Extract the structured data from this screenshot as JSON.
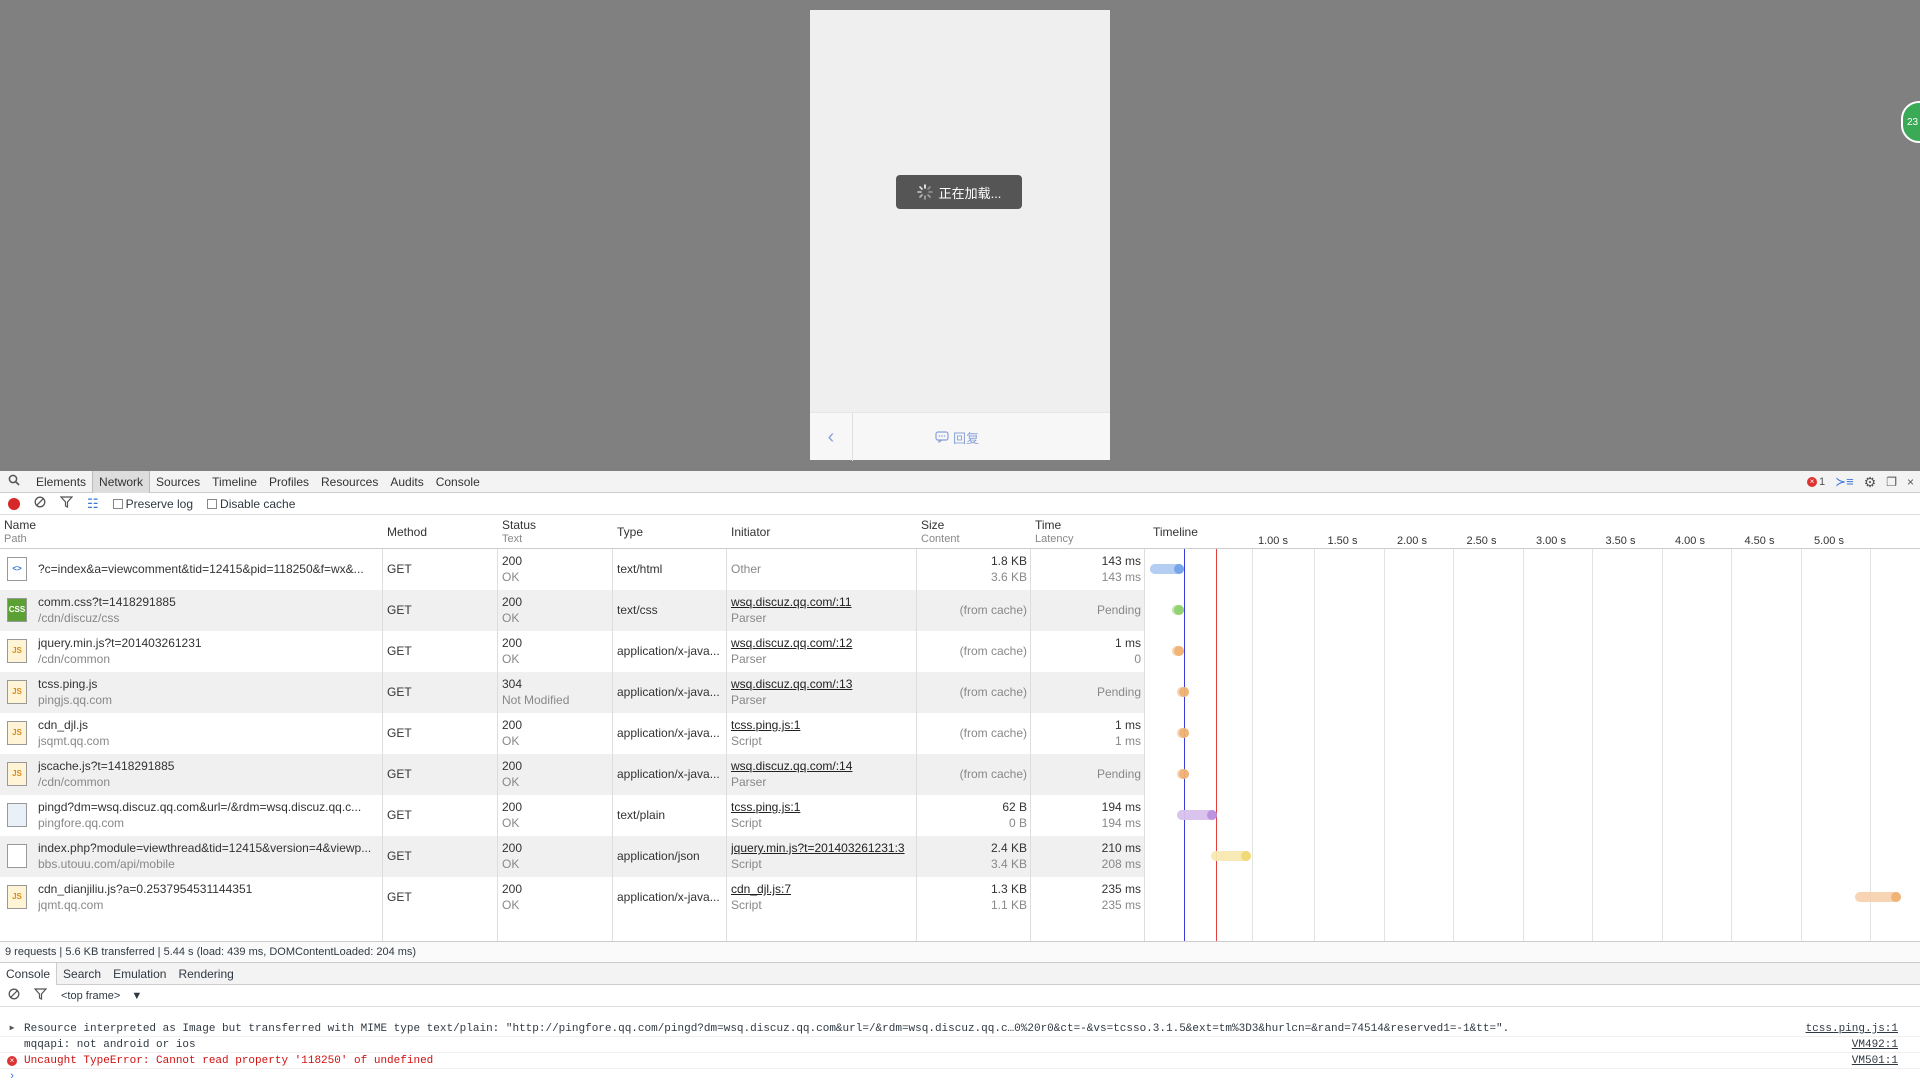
{
  "viewport": {
    "loading_text": "正在加载...",
    "back_icon": "chevron-left-icon",
    "reply_label": "回复",
    "extension_badge": "23"
  },
  "devtools": {
    "main_tabs": [
      "Elements",
      "Network",
      "Sources",
      "Timeline",
      "Profiles",
      "Resources",
      "Audits",
      "Console"
    ],
    "selected_tab": "Network",
    "error_count": "1",
    "toolbar": {
      "preserve_log": "Preserve log",
      "disable_cache": "Disable cache"
    },
    "columns": {
      "name": "Name",
      "name_sub": "Path",
      "method": "Method",
      "status": "Status",
      "status_sub": "Text",
      "type": "Type",
      "initiator": "Initiator",
      "size": "Size",
      "size_sub": "Content",
      "time": "Time",
      "time_sub": "Latency",
      "timeline": "Timeline"
    },
    "timeline_ticks": [
      "1.00 s",
      "1.50 s",
      "2.00 s",
      "2.50 s",
      "3.00 s",
      "3.50 s",
      "4.00 s",
      "4.50 s",
      "5.00 s"
    ],
    "requests": [
      {
        "name": "?c=index&a=viewcomment&tid=12415&pid=118250&f=wx&...",
        "path": "",
        "method": "GET",
        "status": "200",
        "status_text": "OK",
        "type": "text/html",
        "initiator": "Other",
        "initiator_sub": "",
        "initiator_link": false,
        "size": "1.8 KB",
        "content": "3.6 KB",
        "time": "143 ms",
        "latency": "143 ms",
        "icon": "html",
        "color": "#6fa0e8"
      },
      {
        "name": "comm.css?t=1418291885",
        "path": "/cdn/discuz/css",
        "method": "GET",
        "status": "200",
        "status_text": "OK",
        "type": "text/css",
        "initiator": "wsq.discuz.qq.com/:11",
        "initiator_sub": "Parser",
        "initiator_link": true,
        "size": "(from cache)",
        "content": "",
        "time": "Pending",
        "latency": "",
        "icon": "css",
        "color": "#8ed06a"
      },
      {
        "name": "jquery.min.js?t=201403261231",
        "path": "/cdn/common",
        "method": "GET",
        "status": "200",
        "status_text": "OK",
        "type": "application/x-java...",
        "initiator": "wsq.discuz.qq.com/:12",
        "initiator_sub": "Parser",
        "initiator_link": true,
        "size": "(from cache)",
        "content": "",
        "time": "1 ms",
        "latency": "0",
        "icon": "js",
        "color": "#f0b070"
      },
      {
        "name": "tcss.ping.js",
        "path": "pingjs.qq.com",
        "method": "GET",
        "status": "304",
        "status_text": "Not Modified",
        "type": "application/x-java...",
        "initiator": "wsq.discuz.qq.com/:13",
        "initiator_sub": "Parser",
        "initiator_link": true,
        "size": "(from cache)",
        "content": "",
        "time": "Pending",
        "latency": "",
        "icon": "js",
        "color": "#f0b070"
      },
      {
        "name": "cdn_djl.js",
        "path": "jsqmt.qq.com",
        "method": "GET",
        "status": "200",
        "status_text": "OK",
        "type": "application/x-java...",
        "initiator": "tcss.ping.js:1",
        "initiator_sub": "Script",
        "initiator_link": true,
        "size": "(from cache)",
        "content": "",
        "time": "1 ms",
        "latency": "1 ms",
        "icon": "js",
        "color": "#f0b070"
      },
      {
        "name": "jscache.js?t=1418291885",
        "path": "/cdn/common",
        "method": "GET",
        "status": "200",
        "status_text": "OK",
        "type": "application/x-java...",
        "initiator": "wsq.discuz.qq.com/:14",
        "initiator_sub": "Parser",
        "initiator_link": true,
        "size": "(from cache)",
        "content": "",
        "time": "Pending",
        "latency": "",
        "icon": "js",
        "color": "#f0b070"
      },
      {
        "name": "pingd?dm=wsq.discuz.qq.com&url=/&rdm=wsq.discuz.qq.c...",
        "path": "pingfore.qq.com",
        "method": "GET",
        "status": "200",
        "status_text": "OK",
        "type": "text/plain",
        "initiator": "tcss.ping.js:1",
        "initiator_sub": "Script",
        "initiator_link": true,
        "size": "62 B",
        "content": "0 B",
        "time": "194 ms",
        "latency": "194 ms",
        "icon": "img",
        "color": "#b88ee0"
      },
      {
        "name": "index.php?module=viewthread&tid=12415&version=4&viewp...",
        "path": "bbs.utouu.com/api/mobile",
        "method": "GET",
        "status": "200",
        "status_text": "OK",
        "type": "application/json",
        "initiator": "jquery.min.js?t=201403261231:3",
        "initiator_sub": "Script",
        "initiator_link": true,
        "size": "2.4 KB",
        "content": "3.4 KB",
        "time": "210 ms",
        "latency": "208 ms",
        "icon": "blank",
        "color": "#f2d870"
      },
      {
        "name": "cdn_dianjiliu.js?a=0.2537954531144351",
        "path": "jqmt.qq.com",
        "method": "GET",
        "status": "200",
        "status_text": "OK",
        "type": "application/x-java...",
        "initiator": "cdn_djl.js:7",
        "initiator_sub": "Script",
        "initiator_link": true,
        "size": "1.3 KB",
        "content": "1.1 KB",
        "time": "235 ms",
        "latency": "235 ms",
        "icon": "js",
        "color": "#f0b070"
      }
    ],
    "status_bar": "9 requests | 5.6 KB transferred | 5.44 s (load: 439 ms, DOMContentLoaded: 204 ms)",
    "drawer_tabs": [
      "Console",
      "Search",
      "Emulation",
      "Rendering"
    ],
    "frame_selector": "<top frame>",
    "console_lines": [
      {
        "text": "Resource interpreted as Image but transferred with MIME type text/plain: \"http://pingfore.qq.com/pingd?dm=wsq.discuz.qq.com&url=/&rdm=wsq.discuz.qq.c…0%20r0&ct=-&vs=tcsso.3.1.5&ext=tm%3D3&hurlcn=&rand=74514&reserved1=-1&tt=\".",
        "src": "tcss.ping.js:1",
        "kind": "warn"
      },
      {
        "text": "mqqapi: not android or ios",
        "src": "VM492:1",
        "kind": "log"
      },
      {
        "text": "Uncaught TypeError: Cannot read property '118250' of undefined",
        "src": "VM501:1",
        "kind": "error"
      }
    ]
  }
}
